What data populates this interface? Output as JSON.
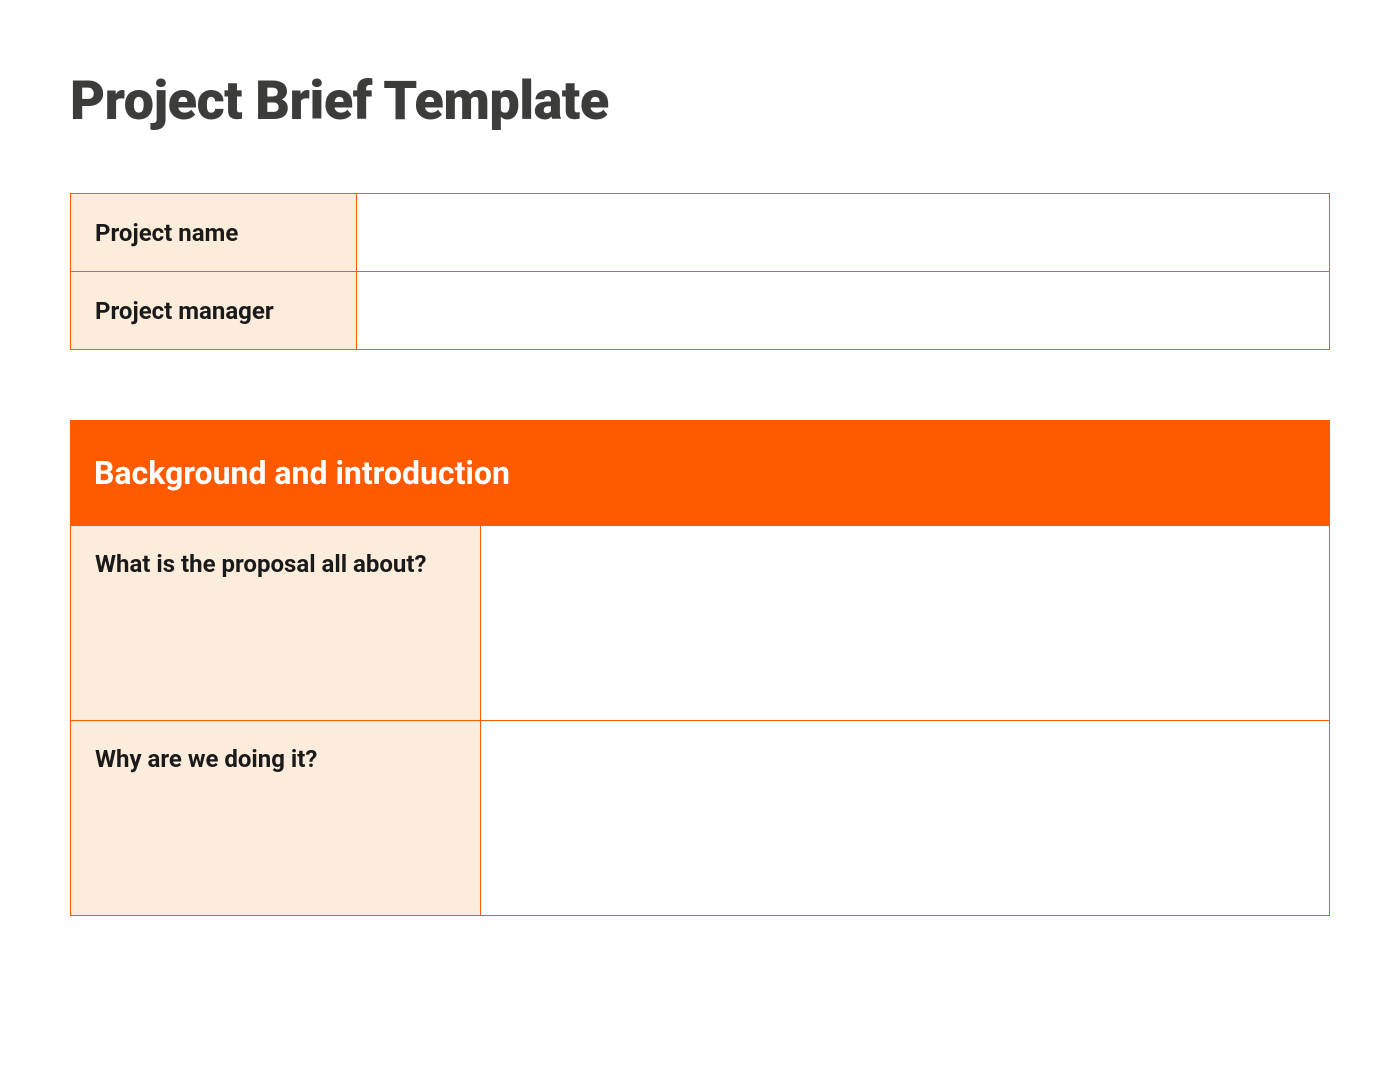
{
  "title": "Project Brief Template",
  "meta": {
    "rows": [
      {
        "label": "Project name",
        "value": ""
      },
      {
        "label": "Project manager",
        "value": ""
      }
    ]
  },
  "section": {
    "heading": "Background and introduction",
    "rows": [
      {
        "question": "What is the proposal all about?",
        "answer": ""
      },
      {
        "question": "Why are we doing it?",
        "answer": ""
      }
    ]
  }
}
